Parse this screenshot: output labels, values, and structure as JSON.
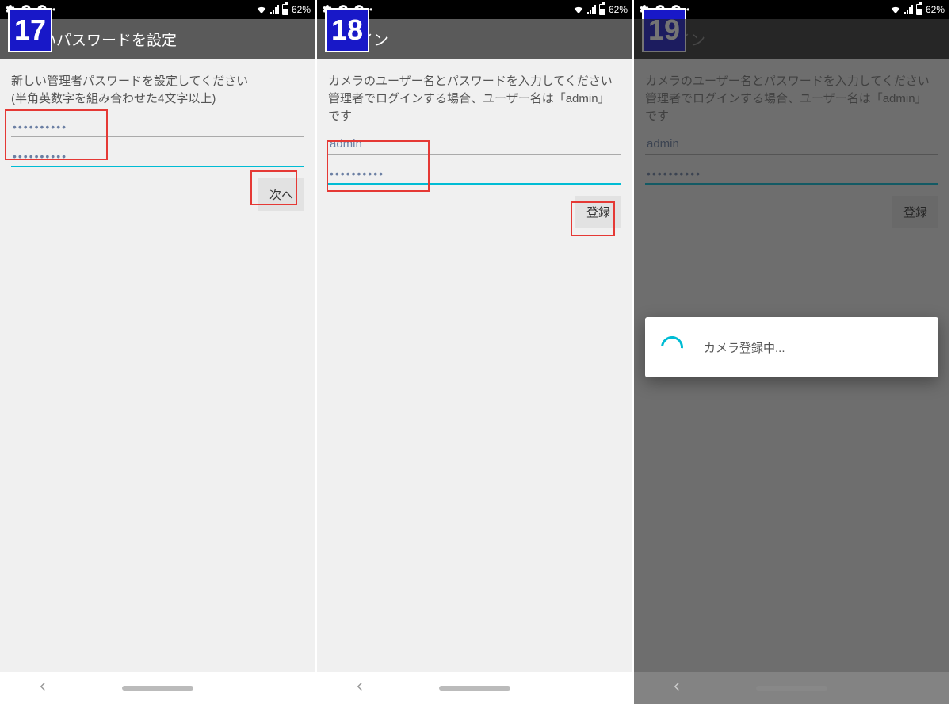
{
  "status": {
    "battery_text": "62%"
  },
  "screens": [
    {
      "step": "17",
      "title": "新しいパスワードを設定",
      "instruction_line1": "新しい管理者パスワードを設定してください",
      "instruction_line2": "(半角英数字を組み合わせた4文字以上)",
      "field1_value": "••••••••••",
      "field2_value": "••••••••••",
      "button_label": "次へ"
    },
    {
      "step": "18",
      "title": "ログイン",
      "instruction_line1": "カメラのユーザー名とパスワードを入力してください",
      "instruction_line2": "管理者でログインする場合、ユーザー名は「admin」です",
      "field1_value": "admin",
      "field2_value": "••••••••••",
      "button_label": "登録"
    },
    {
      "step": "19",
      "title": "ログイン",
      "instruction_line1": "カメラのユーザー名とパスワードを入力してください",
      "instruction_line2": "管理者でログインする場合、ユーザー名は「admin」です",
      "field1_value": "admin",
      "field2_value": "••••••••••",
      "button_label": "登録",
      "dialog_text": "カメラ登録中..."
    }
  ]
}
